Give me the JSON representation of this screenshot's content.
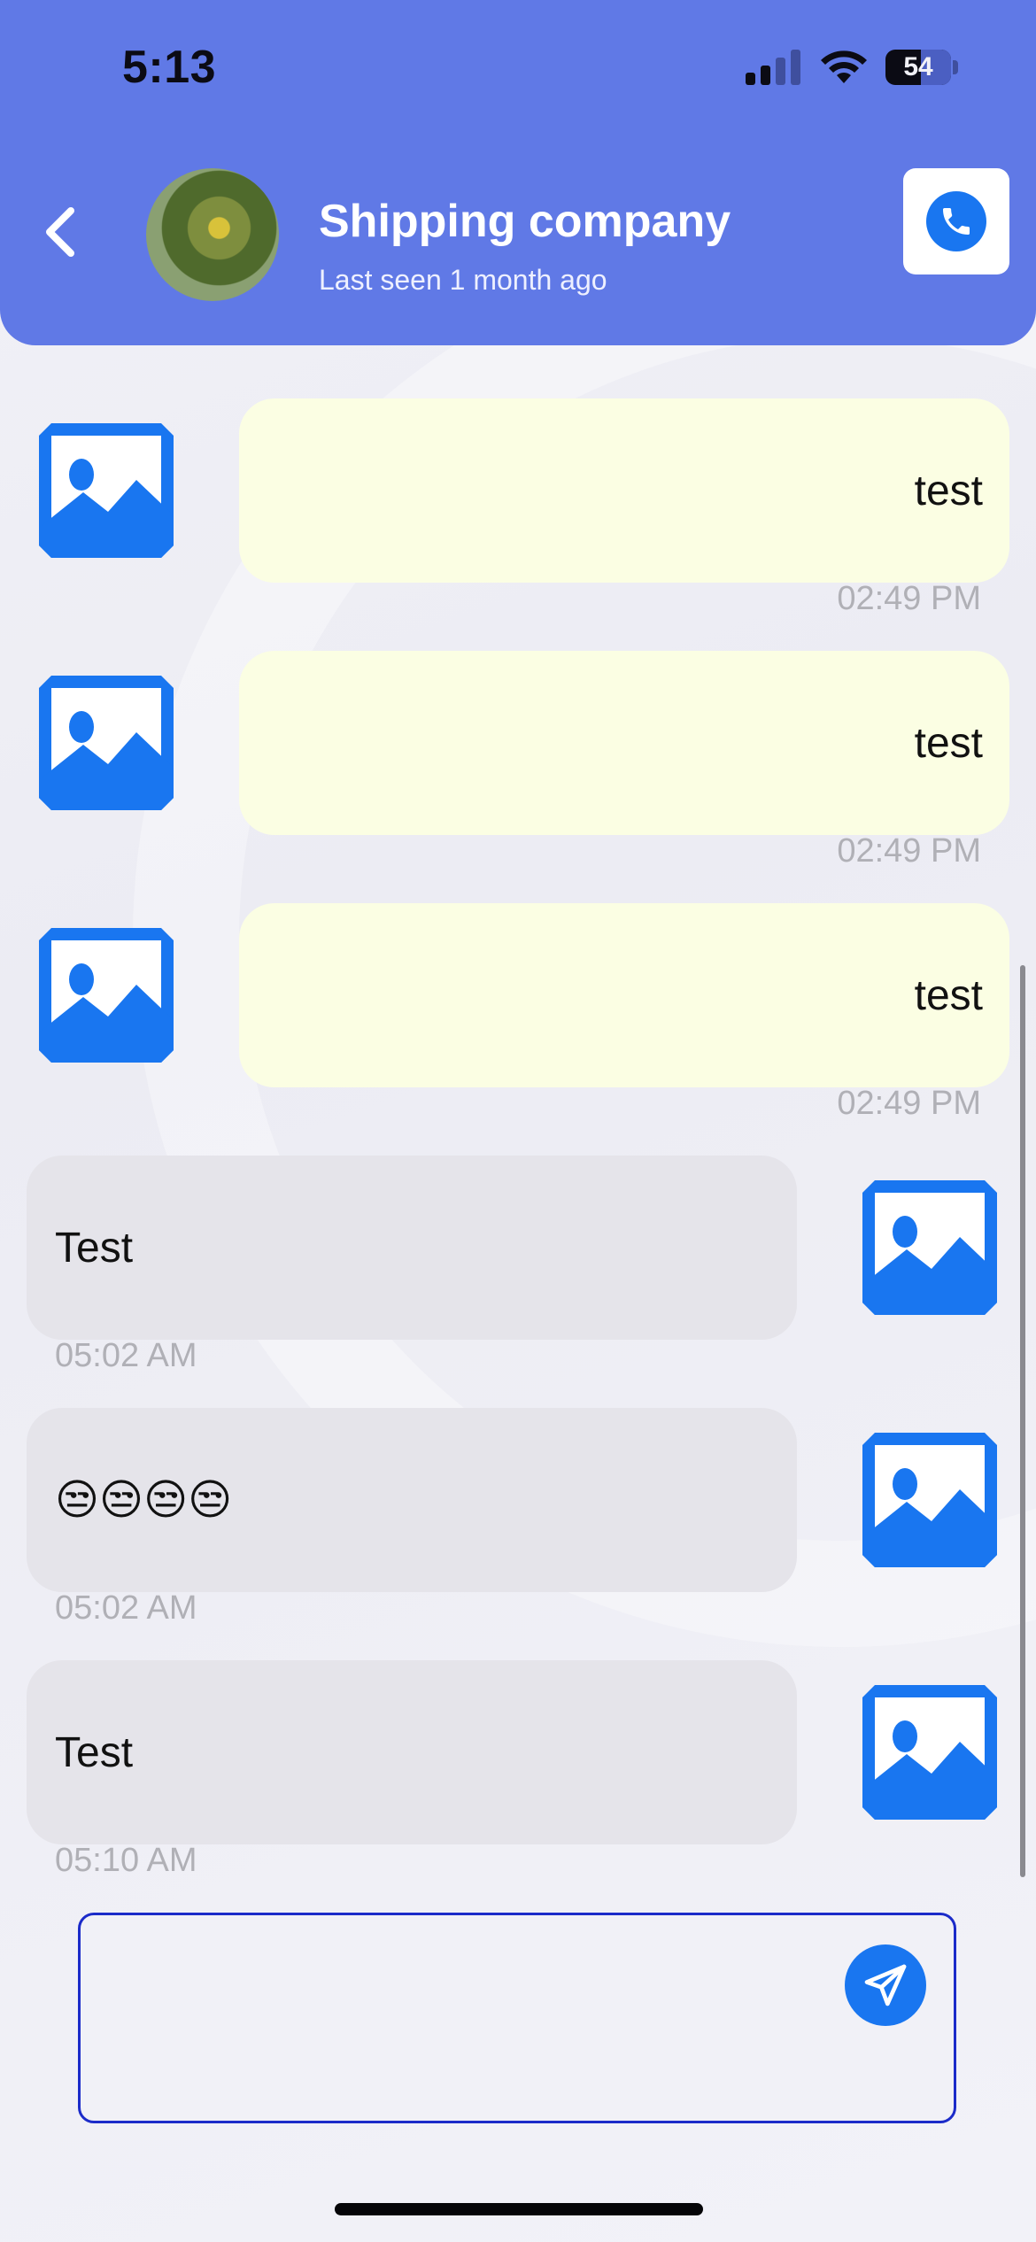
{
  "status_bar": {
    "time": "5:13",
    "battery": "54"
  },
  "header": {
    "contact_name": "Shipping company",
    "contact_status": "Last seen 1 month ago"
  },
  "messages": [
    {
      "direction": "sent",
      "text": "test",
      "time": "02:49 PM"
    },
    {
      "direction": "sent",
      "text": "test",
      "time": "02:49 PM"
    },
    {
      "direction": "sent",
      "text": "test",
      "time": "02:49 PM"
    },
    {
      "direction": "received",
      "text": "Test",
      "time": "05:02 AM"
    },
    {
      "direction": "received",
      "text": "😒😒😒😒",
      "time": "05:02 AM"
    },
    {
      "direction": "received",
      "text": "Test",
      "time": "05:10 AM"
    }
  ],
  "composer": {
    "value": ""
  },
  "colors": {
    "header_bg": "#6079e6",
    "accent": "#1976f0",
    "sent_bubble": "#fbfee3",
    "received_bubble": "#e5e4ea",
    "input_border": "#1b2bc9"
  },
  "icons": {
    "back": "chevron-left-icon",
    "call": "phone-icon",
    "attachment": "image-placeholder-icon",
    "send": "paper-plane-icon"
  }
}
